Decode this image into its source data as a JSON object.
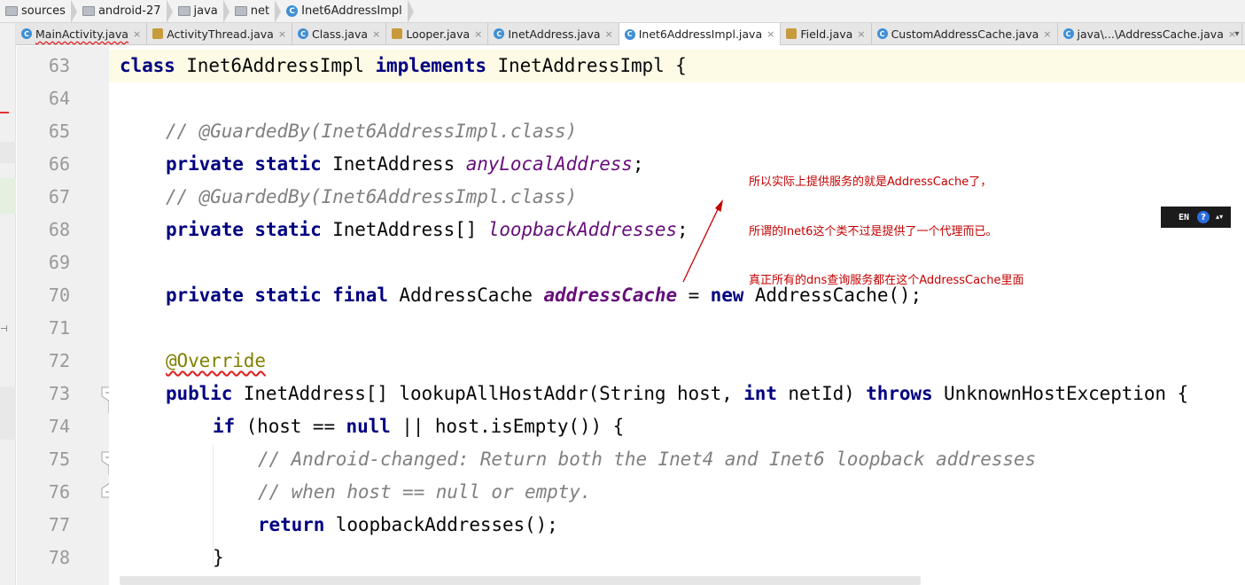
{
  "breadcrumb": [
    "sources",
    "android-27",
    "java",
    "net",
    "Inet6AddressImpl"
  ],
  "tabs": [
    {
      "label": "MainActivity.java",
      "icon": "C",
      "error": true
    },
    {
      "label": "ActivityThread.java",
      "icon": "lib",
      "error": false
    },
    {
      "label": "Class.java",
      "icon": "C",
      "error": false
    },
    {
      "label": "Looper.java",
      "icon": "lib",
      "error": false
    },
    {
      "label": "InetAddress.java",
      "icon": "C",
      "error": false
    },
    {
      "label": "Inet6AddressImpl.java",
      "icon": "C",
      "error": false,
      "active": true
    },
    {
      "label": "Field.java",
      "icon": "C",
      "error": false
    },
    {
      "label": "CustomAddressCache.java",
      "icon": "C",
      "error": false
    },
    {
      "label": "java\\...\\AddressCache.java",
      "icon": "C",
      "error": false
    }
  ],
  "tab_close_glyph": "×",
  "tab_menu_glyph": "▾",
  "class_icon_letter": "C",
  "line_numbers": [
    "63",
    "64",
    "65",
    "66",
    "67",
    "68",
    "69",
    "70",
    "71",
    "72",
    "73",
    "74",
    "75",
    "76",
    "77",
    "78"
  ],
  "code": {
    "l63": {
      "kw1": "class",
      "t1": " Inet6AddressImpl ",
      "kw2": "implements",
      "t2": " InetAddressImpl {"
    },
    "l65": {
      "cm": "// @GuardedBy(Inet6AddressImpl.class)"
    },
    "l66": {
      "kw1": "private",
      "kw2": "static",
      "t": " InetAddress ",
      "fld": "anyLocalAddress",
      "end": ";"
    },
    "l67": {
      "cm": "// @GuardedBy(Inet6AddressImpl.class)"
    },
    "l68": {
      "kw1": "private",
      "kw2": "static",
      "t": " InetAddress[] ",
      "fld": "loopbackAddresses",
      "end": ";"
    },
    "l70": {
      "kw1": "private",
      "kw2": "static",
      "kw3": "final",
      "t": " AddressCache ",
      "fld": "addressCache",
      "t2": " = ",
      "kw4": "new",
      "t3": " AddressCache();"
    },
    "l72": {
      "ann": "@Override"
    },
    "l73": {
      "kw1": "public",
      "t1": " InetAddress[] lookupAllHostAddr(String host, ",
      "kw2": "int",
      "t2": " netId) ",
      "kw3": "throws",
      "t3": " UnknownHostException {"
    },
    "l74": {
      "kw1": "if",
      "t1": " (host == ",
      "kw2": "null",
      "t2": " || host.isEmpty()) {"
    },
    "l75": {
      "cm": "// Android-changed: Return both the Inet4 and Inet6 loopback addresses"
    },
    "l76": {
      "cm": "// when host == null or empty."
    },
    "l77": {
      "kw": "return",
      "t": " loopbackAddresses();"
    },
    "l78": {
      "t": "}"
    }
  },
  "annotation": {
    "lines": [
      "所以实际上提供服务的就是AddressCache了，",
      "所谓的Inet6这个类不过是提供了一个代理而已。",
      "真正所有的dns查询服务都在这个AddressCache里面"
    ],
    "color": "#c40000"
  },
  "ime": {
    "label": "EN",
    "help": "?",
    "arrow": "▴▾"
  },
  "colors": {
    "keyword": "#000080",
    "comment": "#808080",
    "field": "#660e7a",
    "annotation": "#808000",
    "current_line": "#fdfae6"
  }
}
